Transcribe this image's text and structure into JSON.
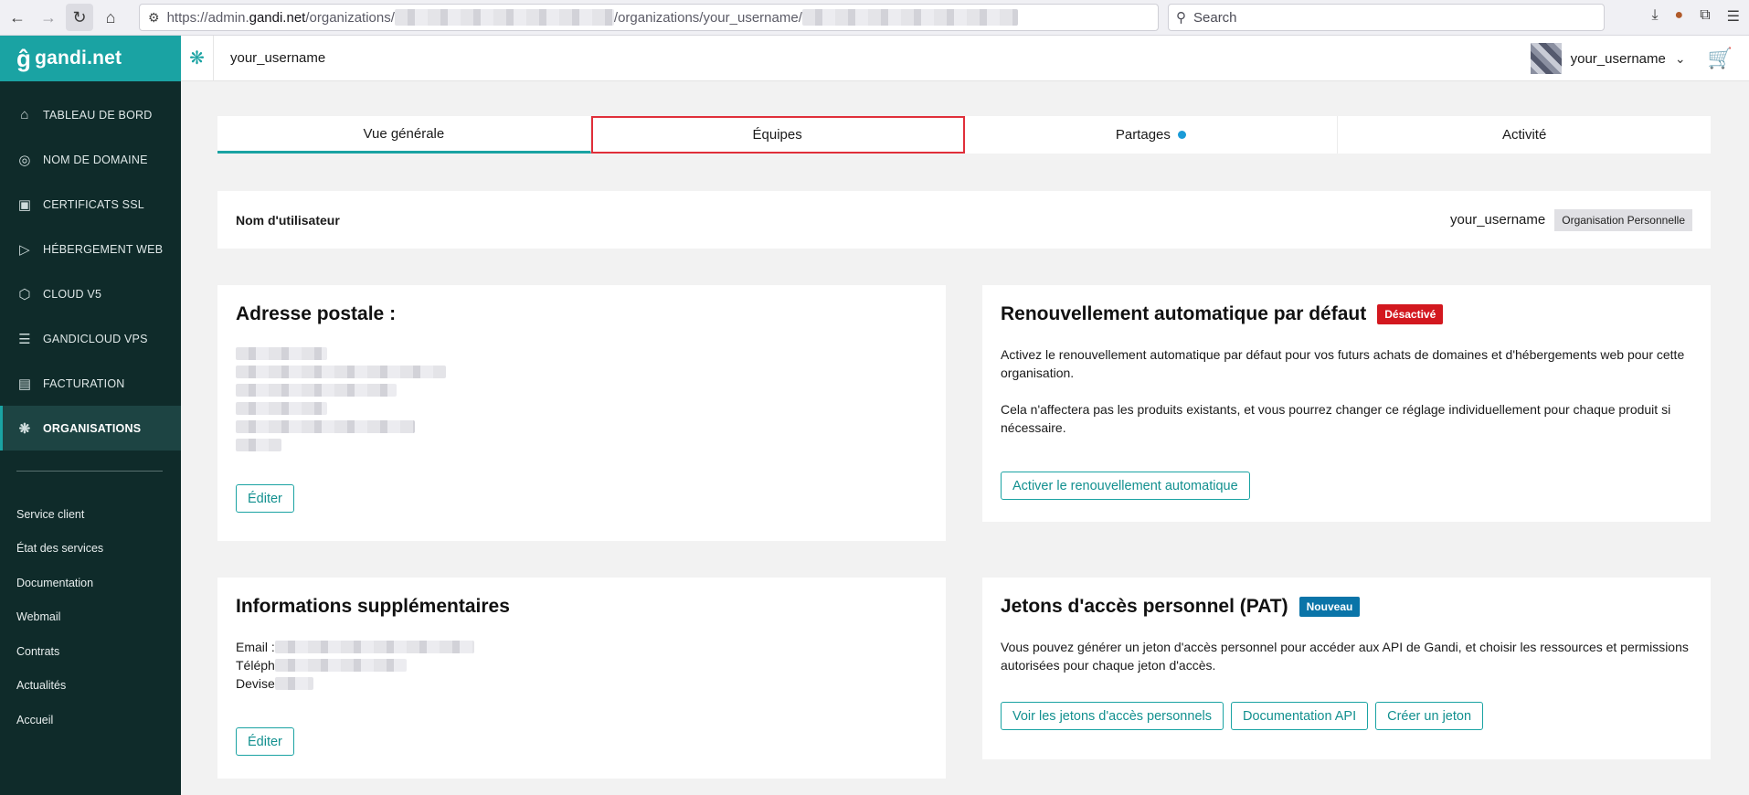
{
  "browser": {
    "url_prefix": "https://admin.",
    "url_host": "gandi.net",
    "url_path1": "/organizations/",
    "url_path2": "/organizations/your_username/",
    "search_placeholder": "Search"
  },
  "sidebar": {
    "logo": "gandi.net",
    "items": [
      {
        "label": "TABLEAU DE BORD",
        "icon": "home-icon"
      },
      {
        "label": "NOM DE DOMAINE",
        "icon": "globe-icon"
      },
      {
        "label": "CERTIFICATS SSL",
        "icon": "certificate-icon"
      },
      {
        "label": "HÉBERGEMENT WEB",
        "icon": "play-icon"
      },
      {
        "label": "CLOUD V5",
        "icon": "cloud-icon"
      },
      {
        "label": "GANDICLOUD VPS",
        "icon": "server-icon"
      },
      {
        "label": "FACTURATION",
        "icon": "card-icon"
      },
      {
        "label": "ORGANISATIONS",
        "icon": "organisation-icon"
      }
    ],
    "links": [
      "Service client",
      "État des services",
      "Documentation",
      "Webmail",
      "Contrats",
      "Actualités",
      "Accueil"
    ]
  },
  "topbar": {
    "breadcrumb": "your_username",
    "user": "your_username"
  },
  "tabs": [
    "Vue générale",
    "Équipes",
    "Partages",
    "Activité"
  ],
  "username_card": {
    "label": "Nom d'utilisateur",
    "value": "your_username",
    "tag": "Organisation Personnelle"
  },
  "address_card": {
    "title": "Adresse postale :",
    "edit": "Éditer"
  },
  "renew_card": {
    "title": "Renouvellement automatique par défaut",
    "badge": "Désactivé",
    "p1": "Activez le renouvellement automatique par défaut pour vos futurs achats de domaines et d'hébergements web pour cette organisation.",
    "p2": "Cela n'affectera pas les produits existants, et vous pourrez changer ce réglage individuellement pour chaque produit si nécessaire.",
    "button": "Activer le renouvellement automatique"
  },
  "info_card": {
    "title": "Informations supplémentaires",
    "email_label": "Email :",
    "phone_label": "Téléph",
    "currency_label": "Devise",
    "edit": "Éditer"
  },
  "pat_card": {
    "title": "Jetons d'accès personnel (PAT)",
    "badge": "Nouveau",
    "text": "Vous pouvez générer un jeton d'accès personnel pour accéder aux API de Gandi, et choisir les ressources et permissions autorisées pour chaque jeton d'accès.",
    "btn1": "Voir les jetons d'accès personnels",
    "btn2": "Documentation API",
    "btn3": "Créer un jeton"
  },
  "colors": {
    "brand_teal": "#1aa3a3",
    "sidebar_bg": "#0f2b2a",
    "badge_red": "#d3181f",
    "badge_blue": "#0a74a8",
    "highlight_outline": "#e02f3a"
  }
}
